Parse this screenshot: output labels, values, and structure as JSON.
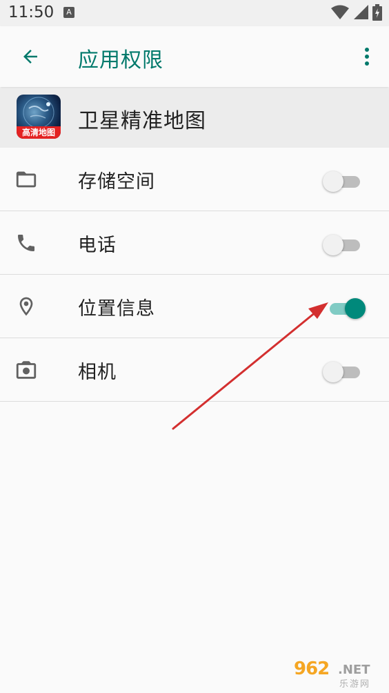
{
  "status_bar": {
    "time": "11:50",
    "notification_icon": "A",
    "icons": [
      "wifi-icon",
      "signal-icon",
      "battery-icon"
    ]
  },
  "app_bar": {
    "title": "应用权限",
    "back_icon": "arrow-left-icon",
    "more_icon": "more-vert-icon"
  },
  "app": {
    "name": "卫星精准地图",
    "icon_label": "高清地图"
  },
  "permissions": [
    {
      "icon": "folder-icon",
      "label": "存储空间",
      "enabled": false
    },
    {
      "icon": "phone-icon",
      "label": "电话",
      "enabled": false
    },
    {
      "icon": "location-icon",
      "label": "位置信息",
      "enabled": true
    },
    {
      "icon": "camera-icon",
      "label": "相机",
      "enabled": false
    }
  ],
  "watermark": {
    "number": "962",
    "domain": ".NET",
    "subtitle": "乐游网"
  },
  "colors": {
    "accent": "#00796b",
    "switch_on_thumb": "#00897b",
    "switch_on_track": "#80cbc4",
    "annotation_arrow": "#d32f2f"
  }
}
